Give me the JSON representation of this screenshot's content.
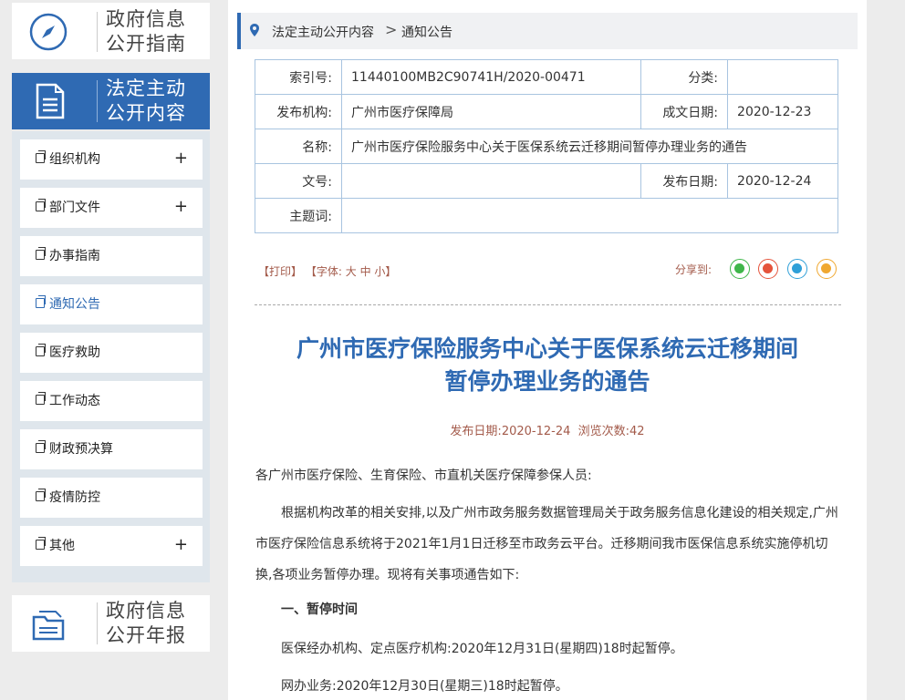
{
  "sidebar": {
    "guide": {
      "line1": "政府信息",
      "line2": "公开指南",
      "icon": "compass-icon"
    },
    "active": {
      "line1": "法定主动",
      "line2": "公开内容",
      "icon": "document-icon"
    },
    "report": {
      "line1": "政府信息",
      "line2": "公开年报",
      "icon": "folder-icon"
    },
    "items": [
      {
        "label": "组织机构",
        "expand": "+"
      },
      {
        "label": "部门文件",
        "expand": "+"
      },
      {
        "label": "办事指南",
        "expand": ""
      },
      {
        "label": "通知公告",
        "expand": ""
      },
      {
        "label": "医疗救助",
        "expand": ""
      },
      {
        "label": "工作动态",
        "expand": ""
      },
      {
        "label": "财政预决算",
        "expand": ""
      },
      {
        "label": "疫情防控",
        "expand": ""
      },
      {
        "label": "其他",
        "expand": "+"
      }
    ],
    "active_index": 3
  },
  "breadcrumb": {
    "level1": "法定主动公开内容",
    "separator": ">",
    "level2": "通知公告"
  },
  "meta": {
    "index_label": "索引号:",
    "index_value": "11440100MB2C90741H/2020-00471",
    "category_label": "分类:",
    "category_value": "",
    "publisher_label": "发布机构:",
    "publisher_value": "广州市医疗保障局",
    "created_label": "成文日期:",
    "created_value": "2020-12-23",
    "name_label": "名称:",
    "name_value": "广州市医疗保险服务中心关于医保系统云迁移期间暂停办理业务的通告",
    "docno_label": "文号:",
    "docno_value": "",
    "published_label": "发布日期:",
    "published_value": "2020-12-24",
    "keywords_label": "主题词:",
    "keywords_value": ""
  },
  "tools": {
    "print": "【打印】",
    "font_prefix": "【字体:",
    "font_large": "大",
    "font_medium": "中",
    "font_small": "小",
    "font_suffix": "】",
    "share_label": "分享到:",
    "share_icons": [
      "wechat-icon",
      "weibo-icon",
      "qq-icon",
      "qzone-icon"
    ]
  },
  "article": {
    "title_line1": "广州市医疗保险服务中心关于医保系统云迁移期间",
    "title_line2": "暂停办理业务的通告",
    "pub_label": "发布日期:",
    "pub_date": "2020-12-24",
    "views_label": "浏览次数:",
    "views": "42",
    "salutation": "各广州市医疗保险、生育保险、市直机关医疗保障参保人员:",
    "para1": "根据机构改革的相关安排,以及广州市政务服务数据管理局关于政务服务信息化建设的相关规定,广州市医疗保险信息系统将于2021年1月1日迁移至市政务云平台。迁移期间我市医保信息系统实施停机切换,各项业务暂停办理。现将有关事项通告如下:",
    "section1": "一、暂停时间",
    "line1": "医保经办机构、定点医疗机构:2020年12月31日(星期四)18时起暂停。",
    "line2": "网办业务:2020年12月30日(星期三)18时起暂停。"
  },
  "colors": {
    "accent": "#2f6ab3",
    "meta_border": "#a8c4e0",
    "tool_text": "#a35a4a"
  }
}
